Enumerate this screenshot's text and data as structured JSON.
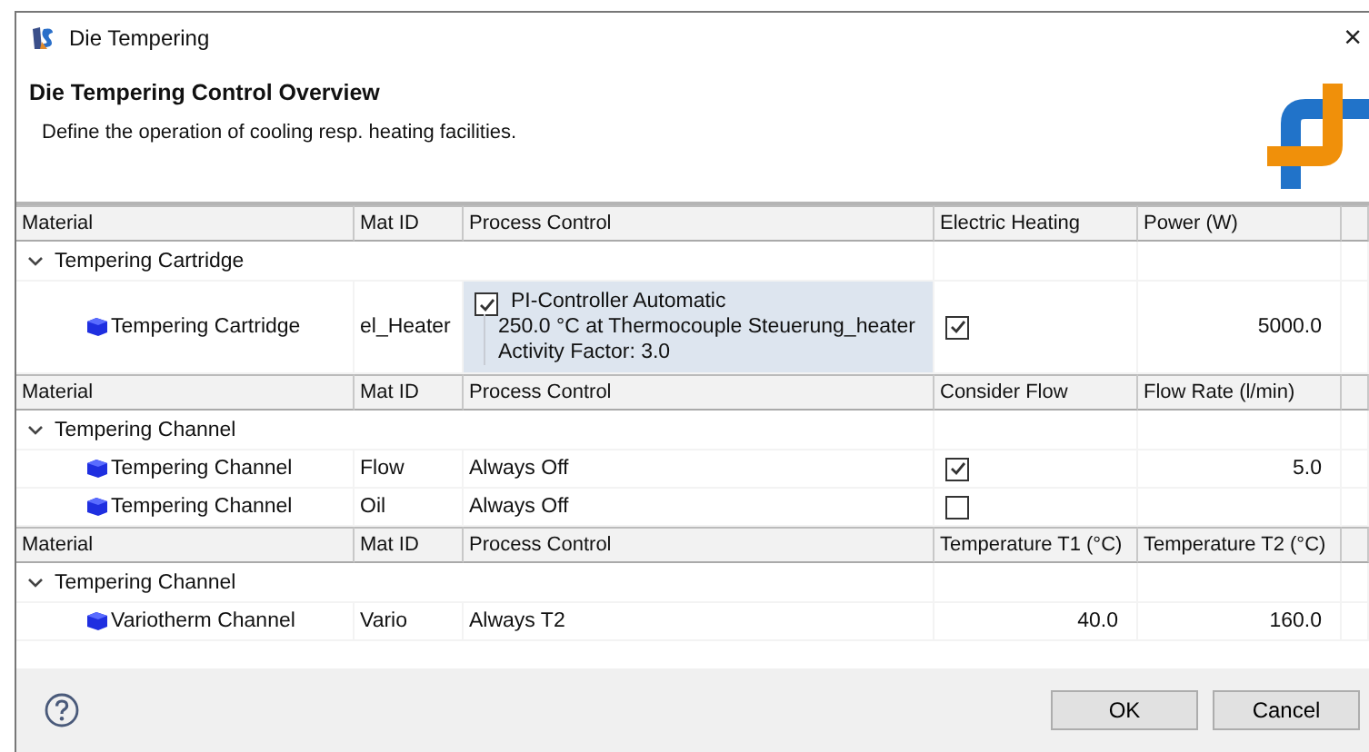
{
  "window": {
    "title": "Die Tempering",
    "close": "×"
  },
  "header": {
    "title": "Die Tempering Control Overview",
    "description": "Define the operation of cooling resp. heating facilities."
  },
  "sections": [
    {
      "columns": [
        "Material",
        "Mat ID",
        "Process Control",
        "Electric Heating",
        "Power (W)"
      ],
      "group": {
        "label": "Tempering Cartridge",
        "expanded": true
      },
      "rows": [
        {
          "cells": [
            {
              "kind": "material",
              "text": "Tempering Cartridge"
            },
            {
              "kind": "text",
              "text": "el_Heater"
            },
            {
              "kind": "controller",
              "checked": true,
              "title": "PI-Controller Automatic",
              "lines": [
                "250.0 °C at Thermocouple Steuerung_heater",
                "Activity Factor: 3.0"
              ]
            },
            {
              "kind": "check",
              "checked": true
            },
            {
              "kind": "number",
              "text": "5000.0"
            }
          ]
        }
      ]
    },
    {
      "columns": [
        "Material",
        "Mat ID",
        "Process Control",
        "Consider Flow",
        "Flow Rate (l/min)"
      ],
      "group": {
        "label": "Tempering Channel",
        "expanded": true
      },
      "rows": [
        {
          "cells": [
            {
              "kind": "material",
              "text": "Tempering Channel"
            },
            {
              "kind": "text",
              "text": "Flow"
            },
            {
              "kind": "text",
              "text": "Always Off"
            },
            {
              "kind": "check",
              "checked": true
            },
            {
              "kind": "number",
              "text": "5.0"
            }
          ]
        },
        {
          "cells": [
            {
              "kind": "material",
              "text": "Tempering Channel"
            },
            {
              "kind": "text",
              "text": "Oil"
            },
            {
              "kind": "text",
              "text": "Always Off"
            },
            {
              "kind": "check",
              "checked": false
            },
            ""
          ]
        }
      ]
    },
    {
      "columns": [
        "Material",
        "Mat ID",
        "Process Control",
        "Temperature T1 (°C)",
        "Temperature T2 (°C)"
      ],
      "group": {
        "label": "Tempering Channel",
        "expanded": true
      },
      "rows": [
        {
          "cells": [
            {
              "kind": "material",
              "text": "Variotherm Channel"
            },
            {
              "kind": "text",
              "text": "Vario"
            },
            {
              "kind": "text",
              "text": "Always T2"
            },
            {
              "kind": "number",
              "text": "40.0"
            },
            {
              "kind": "number",
              "text": "160.0"
            }
          ]
        }
      ]
    }
  ],
  "buttons": [
    "OK",
    "Cancel"
  ]
}
